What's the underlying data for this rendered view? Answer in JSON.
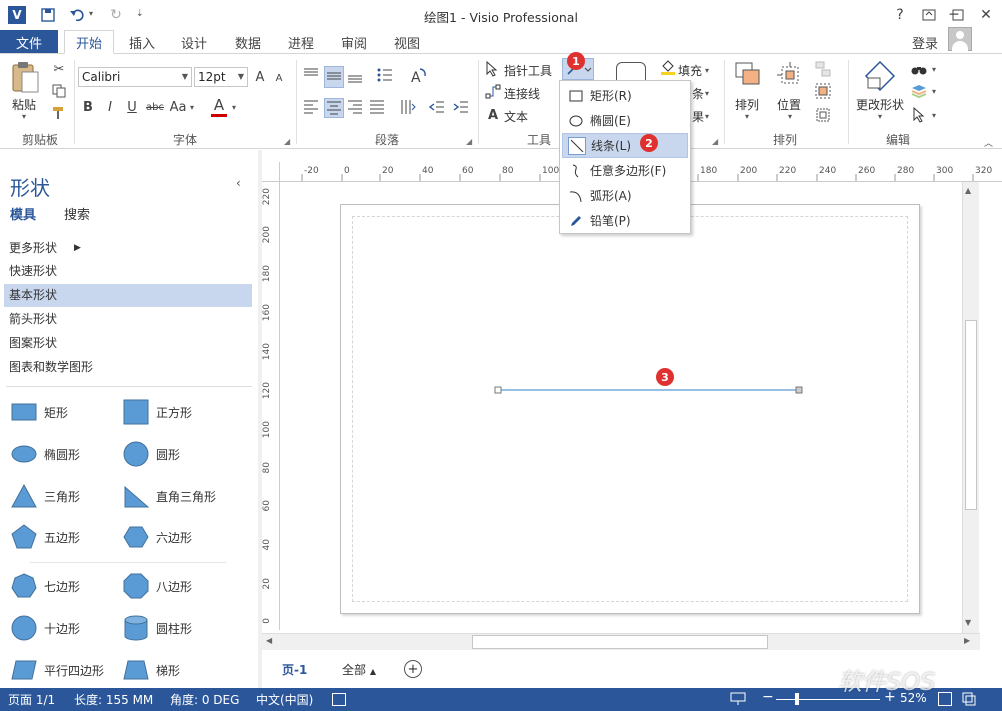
{
  "window": {
    "title": "绘图1 - Visio Professional",
    "help": "?",
    "app_icon": "V"
  },
  "ribbon_tabs": {
    "file": "文件",
    "tabs": [
      "开始",
      "插入",
      "设计",
      "数据",
      "进程",
      "审阅",
      "视图"
    ],
    "active": "开始",
    "login": "登录"
  },
  "clipboard": {
    "paste": "粘贴",
    "label": "剪贴板"
  },
  "font": {
    "name": "Calibri",
    "size": "12pt",
    "label": "字体",
    "bold": "B",
    "italic": "I",
    "underline": "U",
    "strike": "abc",
    "case": "Aa",
    "color_a": "A",
    "grow": "A",
    "shrink": "A"
  },
  "paragraph": {
    "label": "段落"
  },
  "tools": {
    "pointer": "指针工具",
    "connector": "连接线",
    "text": "文本",
    "label": "工具"
  },
  "shape_style": {
    "fill": "填充",
    "line_partial": "条",
    "effect_partial": "果"
  },
  "arrange": {
    "arrange": "排列",
    "position": "位置",
    "label": "排列"
  },
  "editing": {
    "change_shape": "更改形状",
    "label": "编辑"
  },
  "drawing_menu": {
    "items": [
      {
        "label": "矩形(R)"
      },
      {
        "label": "椭圆(E)"
      },
      {
        "label": "线条(L)"
      },
      {
        "label": "任意多边形(F)"
      },
      {
        "label": "弧形(A)"
      },
      {
        "label": "铅笔(P)"
      }
    ],
    "highlighted": "线条(L)"
  },
  "badges": [
    "1",
    "2",
    "3"
  ],
  "shapes_panel": {
    "title": "形状",
    "tabs": [
      "模具",
      "搜索"
    ],
    "stencils": [
      "更多形状",
      "快速形状",
      "基本形状",
      "箭头形状",
      "图案形状",
      "图表和数学图形"
    ],
    "selected_stencil": "基本形状",
    "shapes": [
      "矩形",
      "正方形",
      "椭圆形",
      "圆形",
      "三角形",
      "直角三角形",
      "五边形",
      "六边形",
      "七边形",
      "八边形",
      "十边形",
      "圆柱形",
      "平行四边形",
      "梯形"
    ]
  },
  "rulers": {
    "horizontal": [
      "-20",
      "0",
      "20",
      "40",
      "60",
      "80",
      "100",
      "180",
      "200",
      "220",
      "240",
      "260",
      "280",
      "300",
      "320"
    ],
    "vertical": [
      "220",
      "200",
      "180",
      "160",
      "140",
      "120",
      "100",
      "80",
      "60",
      "40",
      "20",
      "0"
    ]
  },
  "page_tabs": {
    "page": "页-1",
    "all": "全部"
  },
  "status": {
    "page": "页面 1/1",
    "length": "长度: 155 MM",
    "angle": "角度: 0 DEG",
    "language": "中文(中国)",
    "zoom": "52%"
  },
  "watermark": "软件SOS",
  "colors": {
    "accent": "#2b579a",
    "badge": "#e03131",
    "selection": "#c9d7ee",
    "shape_fill": "#5b9bd5"
  }
}
